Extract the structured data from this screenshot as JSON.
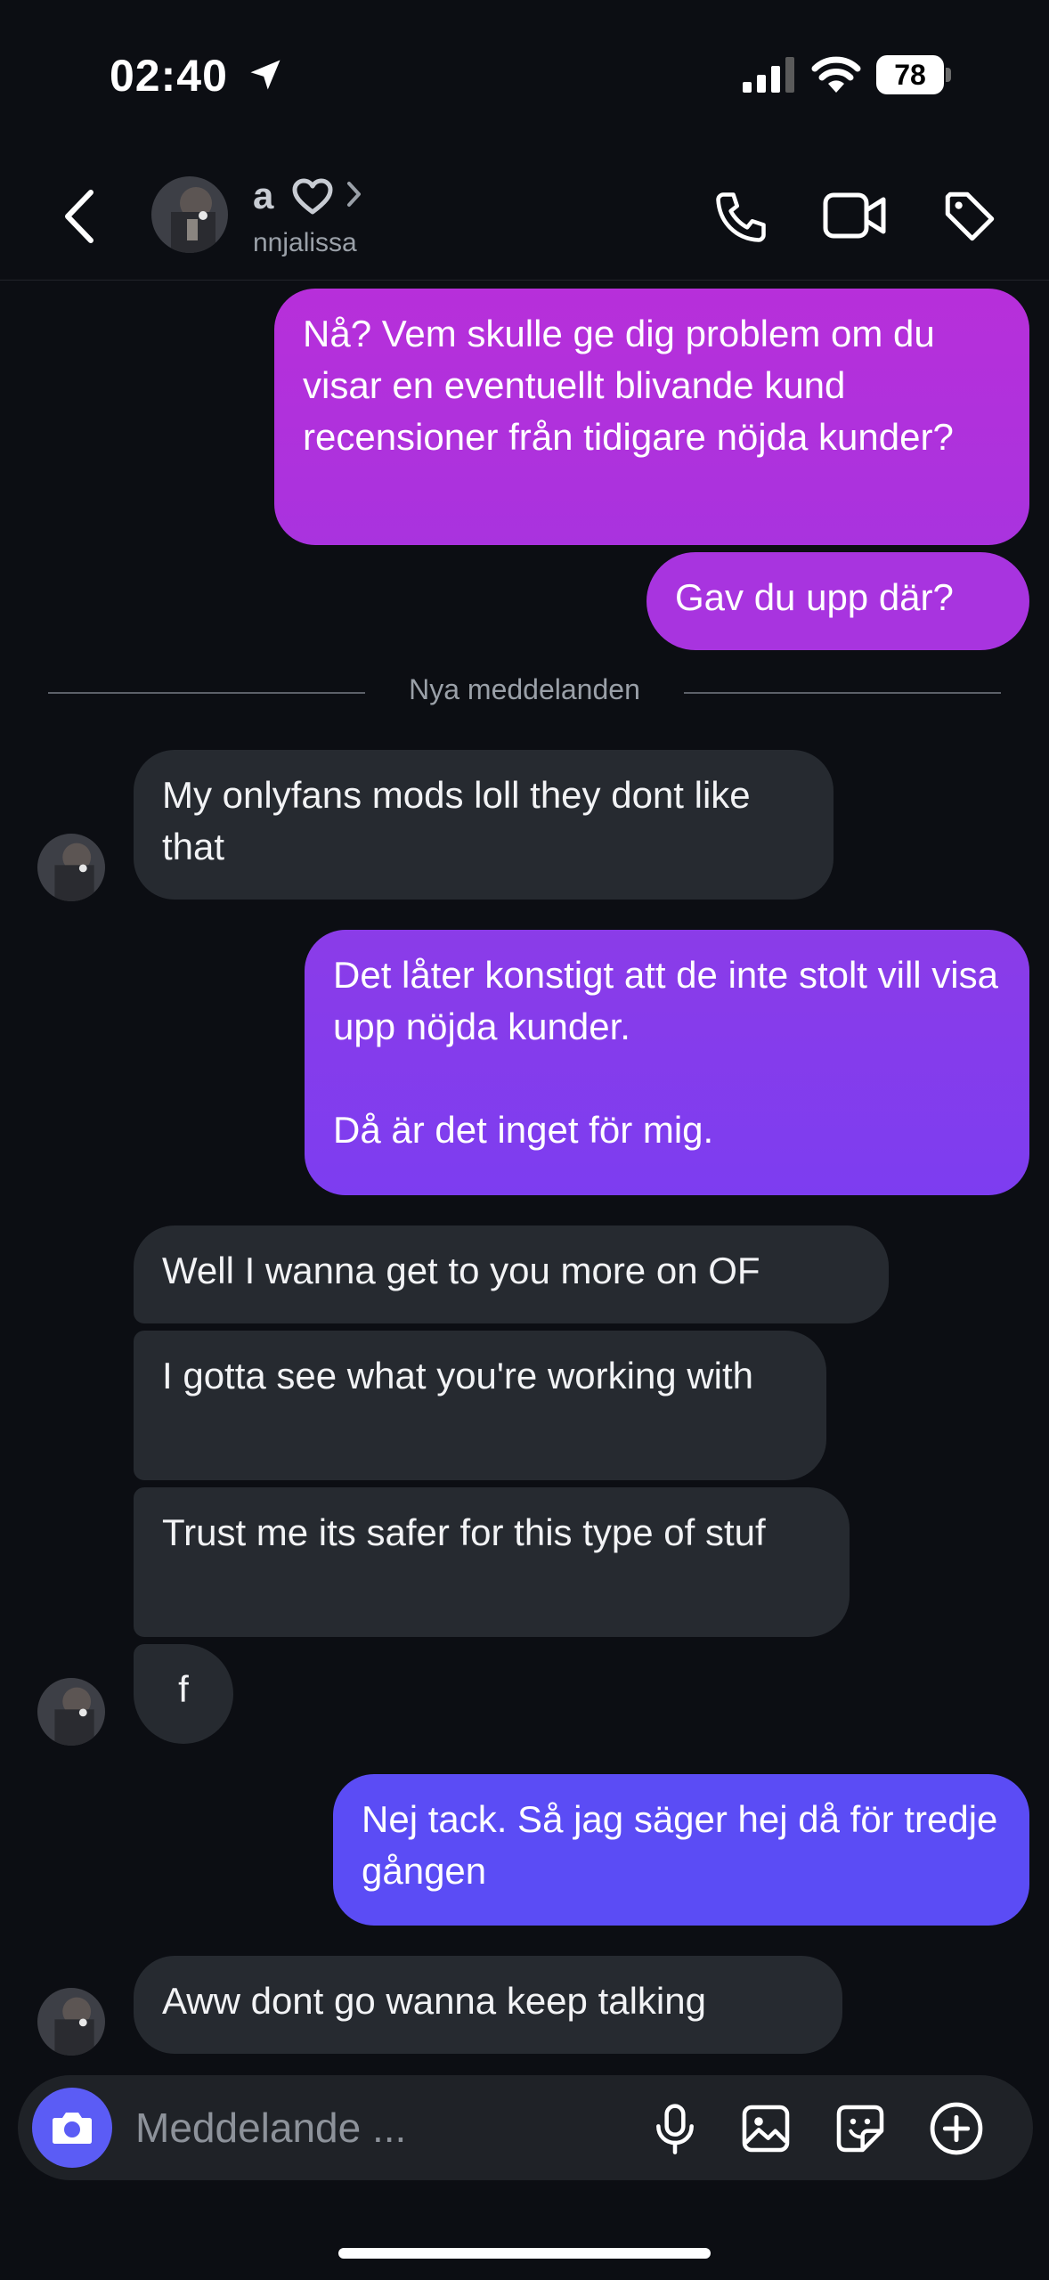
{
  "status_bar": {
    "time": "02:40",
    "battery": "78"
  },
  "header": {
    "name": "a",
    "username": "nnjalissa"
  },
  "divider": {
    "label": "Nya meddelanden"
  },
  "messages": [
    {
      "from": "me",
      "text": "Nå? Vem skulle ge dig problem om du visar en eventuellt blivande kund recensioner från tidigare nöjda kunder?"
    },
    {
      "from": "me",
      "text": "Gav du upp där?"
    },
    {
      "from": "them",
      "text": "My onlyfans mods loll they dont like that"
    },
    {
      "from": "me",
      "text": "Det låter konstigt att de inte stolt vill visa upp nöjda kunder.\n\nDå är det inget för mig."
    },
    {
      "from": "them",
      "text": "Well I wanna get to you more on OF"
    },
    {
      "from": "them",
      "text": "I gotta see what you're working with"
    },
    {
      "from": "them",
      "text": "Trust me its safer for this type of stuf"
    },
    {
      "from": "them",
      "text": "f"
    },
    {
      "from": "me",
      "text": "Nej tack. Så jag säger hej då för tredje gången"
    },
    {
      "from": "them",
      "text": "Aww dont go wanna keep talking"
    }
  ],
  "composer": {
    "placeholder": "Meddelande ..."
  },
  "colors": {
    "background": "#0c0e13",
    "incoming_bubble": "#262a30",
    "outgoing_top": "#b62fdb",
    "outgoing_bottom": "#5b4cf5",
    "camera_button": "#5b5cf5"
  }
}
